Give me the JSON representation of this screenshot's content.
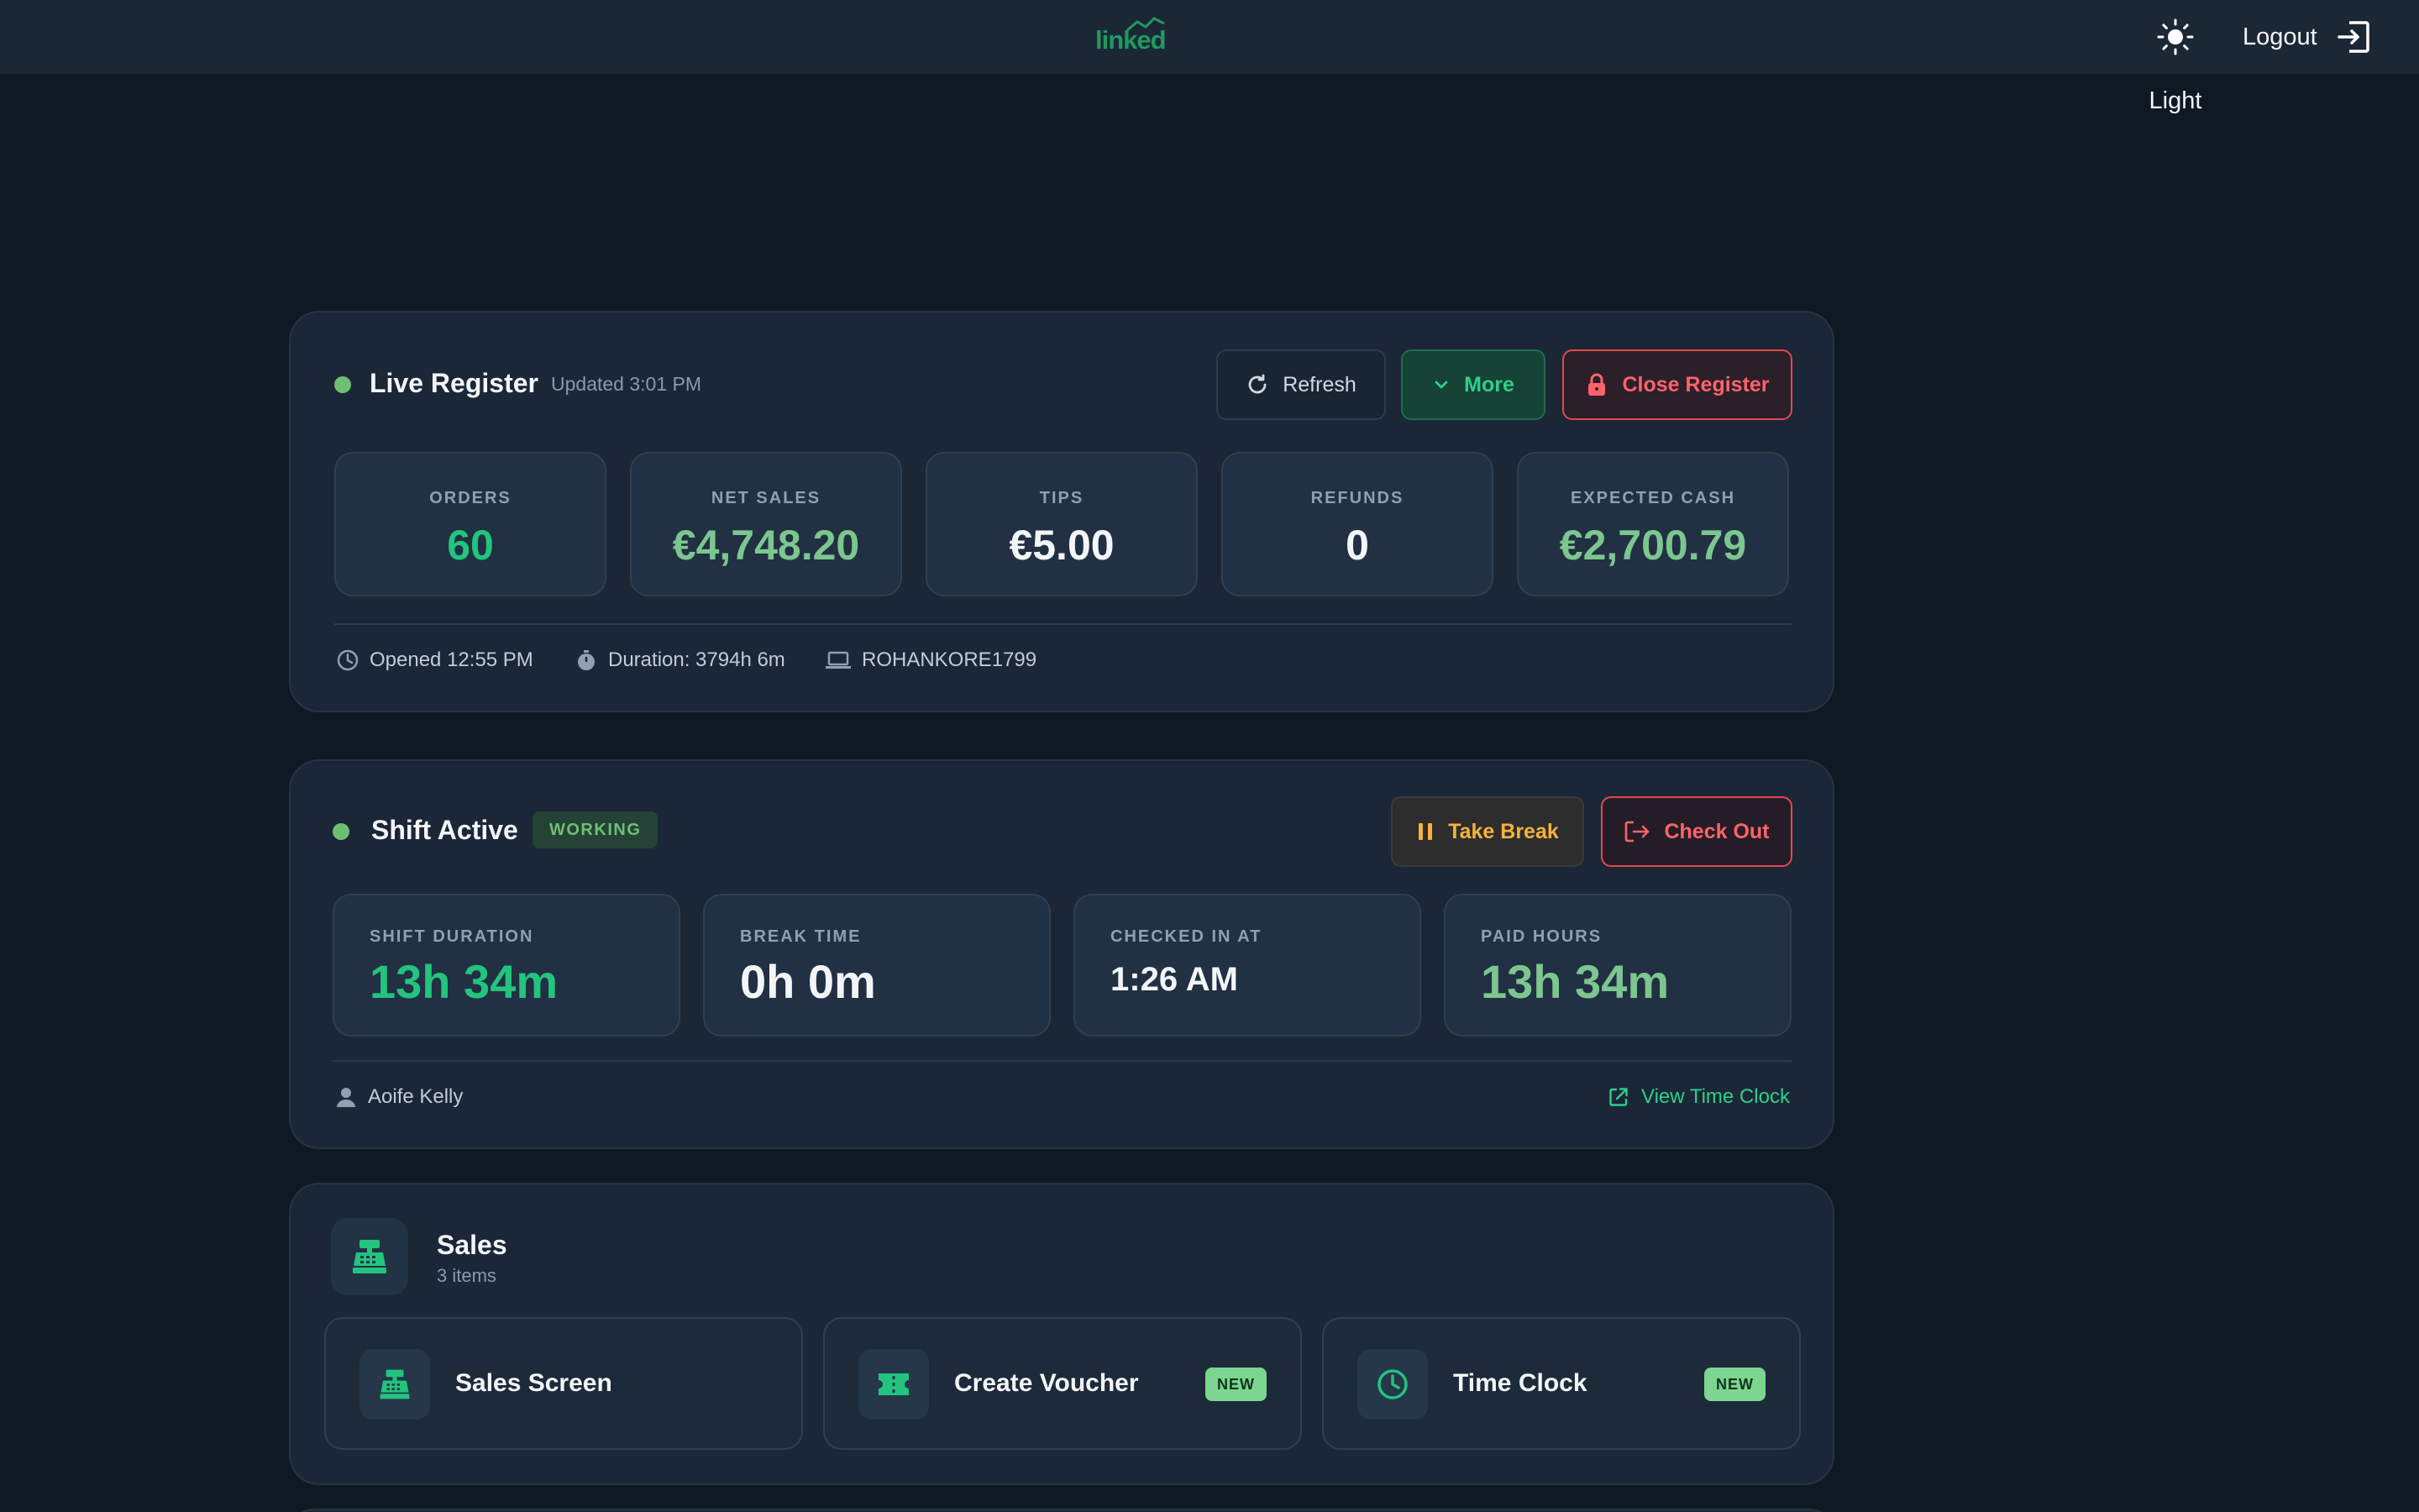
{
  "topbar": {
    "logo_text": "linked",
    "theme_tooltip": "Light",
    "logout_label": "Logout"
  },
  "register": {
    "title": "Live Register",
    "updated": "Updated 3:01 PM",
    "refresh_label": "Refresh",
    "more_label": "More",
    "close_label": "Close Register",
    "stats": [
      {
        "label": "ORDERS",
        "value": "60"
      },
      {
        "label": "NET SALES",
        "value": "€4,748.20"
      },
      {
        "label": "TIPS",
        "value": "€5.00"
      },
      {
        "label": "REFUNDS",
        "value": "0"
      },
      {
        "label": "EXPECTED CASH",
        "value": "€2,700.79"
      }
    ],
    "opened": "Opened 12:55 PM",
    "duration": "Duration: 3794h 6m",
    "device": "ROHANKORE1799"
  },
  "shift": {
    "title": "Shift Active",
    "status_badge": "WORKING",
    "break_label": "Take Break",
    "checkout_label": "Check Out",
    "stats": [
      {
        "label": "SHIFT DURATION",
        "value": "13h 34m"
      },
      {
        "label": "BREAK TIME",
        "value": "0h 0m"
      },
      {
        "label": "CHECKED IN AT",
        "value": "1:26 AM"
      },
      {
        "label": "PAID HOURS",
        "value": "13h 34m"
      }
    ],
    "employee": "Aoife Kelly",
    "time_clock_link": "View Time Clock"
  },
  "sales": {
    "title": "Sales",
    "count": "3 items",
    "tiles": [
      {
        "label": "Sales Screen",
        "icon": "cash-register-icon",
        "badge": ""
      },
      {
        "label": "Create Voucher",
        "icon": "ticket-icon",
        "badge": "NEW"
      },
      {
        "label": "Time Clock",
        "icon": "clock-icon",
        "badge": "NEW"
      }
    ]
  },
  "colors": {
    "background": "#0f1923",
    "card": "#1b2737",
    "accent_green": "#22c47e",
    "danger": "#e5484d",
    "warning": "#f5b33c"
  }
}
